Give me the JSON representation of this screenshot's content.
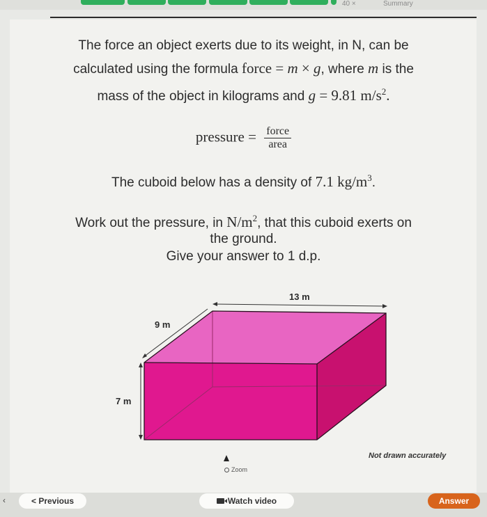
{
  "header": {
    "tabs": [
      "",
      "",
      "",
      "",
      "",
      "",
      "",
      ""
    ],
    "count_label": "40 ×",
    "summary_label": "Summary"
  },
  "question": {
    "line1": "The force an object exerts due to its weight, in N, can be",
    "line2_pre": "calculated using the formula force = ",
    "line2_m": "m",
    "line2_times": " × ",
    "line2_g": "g",
    "line2_post": ", where ",
    "line2_m2": "m",
    "line2_end": " is the",
    "line3_pre": "mass of the object in kilograms and ",
    "line3_g": "g",
    "line3_eq": " = 9.81 m/s",
    "line3_exp": "2",
    "line3_end": ".",
    "pressure_label": "pressure =",
    "pressure_num": "force",
    "pressure_den": "area",
    "density_pre": "The cuboid below has a density of ",
    "density_val": "7.1 kg/m",
    "density_exp": "3",
    "density_end": ".",
    "work_pre": "Work out the pressure, in ",
    "work_unit": "N/m",
    "work_exp": "2",
    "work_post": ", that this cuboid exerts on",
    "work_line2": "the ground.",
    "give": "Give your answer to 1 d.p."
  },
  "diagram": {
    "length_label": "13 m",
    "width_label": "9 m",
    "height_label": "7 m",
    "note": "Not drawn accurately",
    "colors": {
      "top": "#e865c2",
      "front": "#e0188f",
      "side": "#c8116f",
      "edge": "#2a1020",
      "back_edge": "#9a2a6a"
    }
  },
  "zoom_label": "Zoom",
  "buttons": {
    "previous": "< Previous",
    "watch_video": "Watch video",
    "answer": "Answer"
  },
  "colors": {
    "accent_green": "#2fae5c",
    "answer_orange": "#d8641c"
  }
}
